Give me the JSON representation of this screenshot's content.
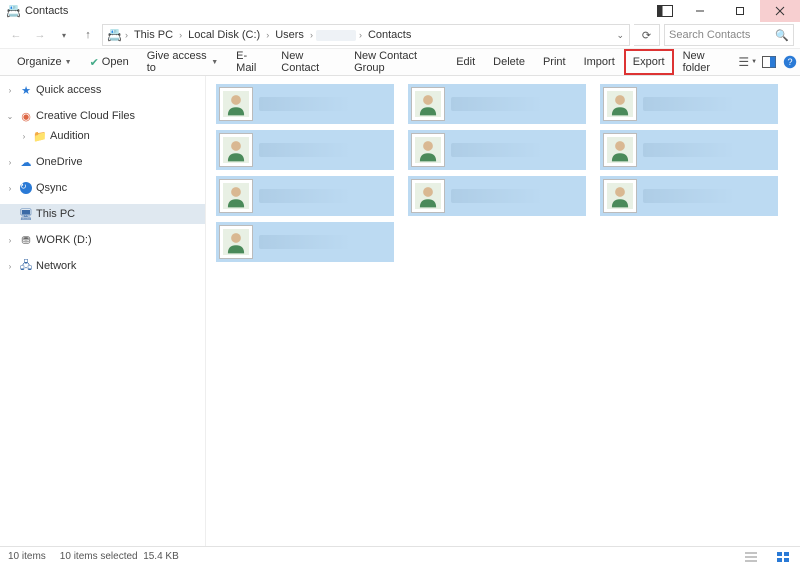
{
  "window": {
    "title": "Contacts"
  },
  "breadcrumb": {
    "segments": [
      "This PC",
      "Local Disk (C:)",
      "Users",
      "",
      "Contacts"
    ]
  },
  "search": {
    "placeholder": "Search Contacts"
  },
  "toolbar": {
    "organize": "Organize",
    "open": "Open",
    "give_access": "Give access to",
    "email": "E-Mail",
    "new_contact": "New Contact",
    "new_group": "New Contact Group",
    "edit": "Edit",
    "delete": "Delete",
    "print": "Print",
    "import": "Import",
    "export": "Export",
    "new_folder": "New folder"
  },
  "nav": {
    "quick_access": "Quick access",
    "creative_cloud": "Creative Cloud Files",
    "audition": "Audition",
    "onedrive": "OneDrive",
    "qsync": "Qsync",
    "this_pc": "This PC",
    "work_d": "WORK (D:)",
    "network": "Network"
  },
  "contacts": {
    "count": 10
  },
  "status": {
    "items": "10 items",
    "selected": "10 items selected",
    "size": "15.4 KB"
  }
}
